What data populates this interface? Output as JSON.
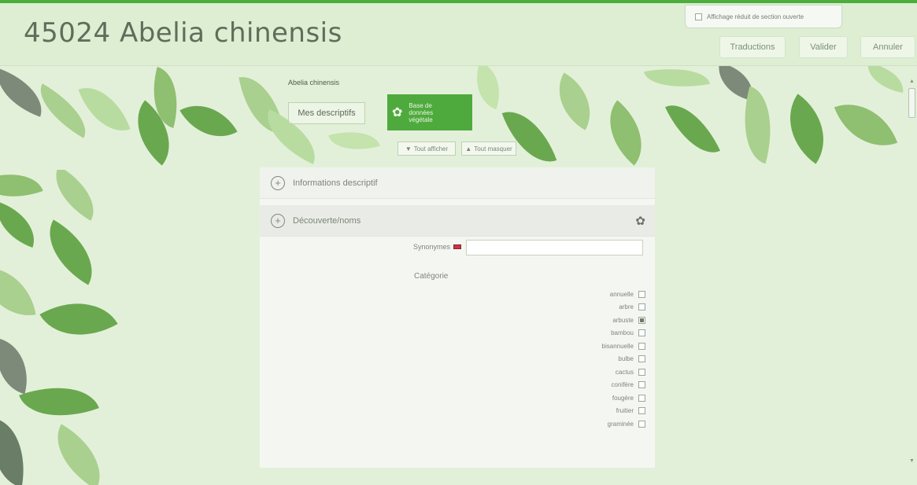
{
  "header": {
    "title": "45024 Abelia chinensis",
    "display_toggle_label": "Affichage réduit de section ouverte",
    "display_toggle_checked": false,
    "buttons": {
      "translations": "Traductions",
      "validate": "Valider",
      "cancel": "Annuler"
    }
  },
  "banner": {
    "species_label": "Abelia chinensis",
    "tabs": {
      "my_descriptions": "Mes descriptifs",
      "plant_database": "Base de données végétale"
    },
    "show_all": "Tout afficher",
    "hide_all": "Tout masquer",
    "show_all_icon": "▼",
    "hide_all_icon": "▲",
    "plant_icon": "plant-icon"
  },
  "panel": {
    "sections": [
      {
        "label": "Informations descriptif",
        "expand_icon": "+"
      },
      {
        "label": "Découverte/noms",
        "expand_icon": "+",
        "icon": "plant-icon"
      }
    ],
    "synonyms_label": "Synonymes",
    "synonyms_value": "",
    "category_label": "Catégorie",
    "categories": [
      {
        "label": "annuelle",
        "checked": false
      },
      {
        "label": "arbre",
        "checked": false
      },
      {
        "label": "arbuste",
        "checked": true
      },
      {
        "label": "bambou",
        "checked": false
      },
      {
        "label": "bisannuelle",
        "checked": false
      },
      {
        "label": "bulbe",
        "checked": false
      },
      {
        "label": "cactus",
        "checked": false
      },
      {
        "label": "conifère",
        "checked": false
      },
      {
        "label": "fougère",
        "checked": false
      },
      {
        "label": "fruitier",
        "checked": false
      },
      {
        "label": "graminée",
        "checked": false
      }
    ]
  },
  "colors": {
    "accent": "#4cae3c",
    "background": "#e3f0d9",
    "leaf_dark": "#6aa84f",
    "leaf_light": "#a9d08e",
    "leaf_grey": "#7d8a7a"
  }
}
